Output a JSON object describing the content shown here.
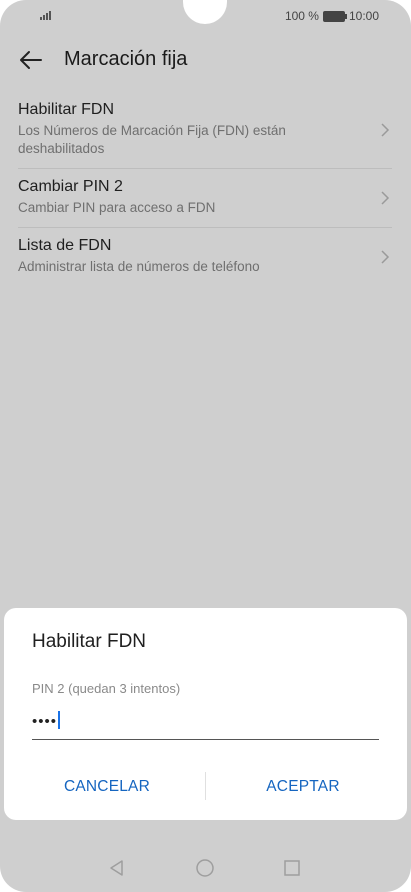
{
  "status_bar": {
    "battery_text": "100 %",
    "time": "10:00"
  },
  "app_bar": {
    "title": "Marcación fija"
  },
  "list": {
    "items": [
      {
        "title": "Habilitar FDN",
        "subtitle": "Los Números de Marcación Fija (FDN) están deshabilitados"
      },
      {
        "title": "Cambiar PIN 2",
        "subtitle": "Cambiar PIN para acceso a FDN"
      },
      {
        "title": "Lista de FDN",
        "subtitle": "Administrar lista de números de teléfono"
      }
    ]
  },
  "dialog": {
    "title": "Habilitar FDN",
    "field_label": "PIN 2 (quedan 3 intentos)",
    "field_value": "••••",
    "cancel_label": "CANCELAR",
    "accept_label": "ACEPTAR"
  },
  "colors": {
    "accent": "#1565c0",
    "scrim_background": "#cfcfcf",
    "caret": "#1a73e8"
  },
  "icons": {
    "back": "arrow-left-icon",
    "chevron": "chevron-right-icon",
    "nav_back": "triangle-back-icon",
    "nav_home": "circle-home-icon",
    "nav_recents": "square-recents-icon"
  }
}
